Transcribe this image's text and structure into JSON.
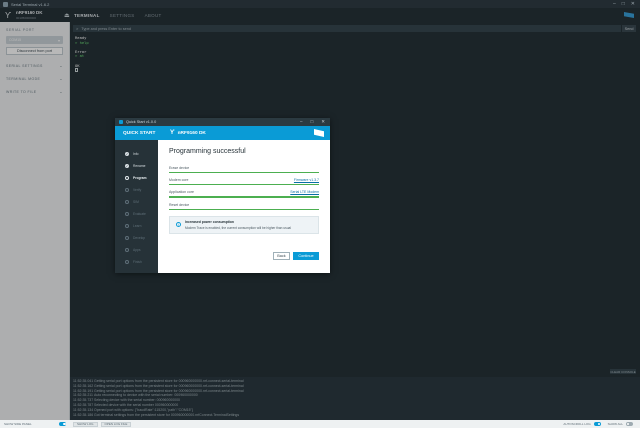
{
  "window": {
    "title": "Serial Terminal v1.6.2",
    "controls": [
      "–",
      "□",
      "✕"
    ]
  },
  "header": {
    "device_name": "nRF9160 DK",
    "device_serial": "001050000000",
    "tabs": [
      {
        "label": "TERMINAL",
        "active": true
      },
      {
        "label": "SETTINGS",
        "active": false
      },
      {
        "label": "ABOUT",
        "active": false
      }
    ]
  },
  "sidebar": {
    "serial_port_title": "SERIAL PORT",
    "port_value": "COM15",
    "disconnect_label": "Disconnect from port",
    "sections": [
      {
        "label": "SERIAL SETTINGS"
      },
      {
        "label": "TERMINAL MODE"
      },
      {
        "label": "WRITE TO FILE"
      }
    ]
  },
  "terminal": {
    "input_prompt": ">",
    "input_placeholder": "Type and press Enter to send",
    "send_label": "Send",
    "lines": [
      "Ready",
      "> help",
      "",
      "Error",
      "> at",
      "",
      "OK"
    ],
    "clear_label": "CLEAR CONSOLE"
  },
  "log": [
    {
      "time": "11:52:35.041",
      "msg": "Getting serial port options from the persistent store for 000960000000.nrf-connect-serial-terminal"
    },
    {
      "time": "11:52:35.162",
      "msg": "Getting serial port options from the persistent store for 000960000000.nrf-connect-serial-terminal"
    },
    {
      "time": "11:52:35.191",
      "msg": "Getting serial port options from the persistent store for 000960000000.nrf-connect-serial-terminal"
    },
    {
      "time": "11:52:35.211",
      "msg": "Auto reconnecting to device with the serial number: 000960000000"
    },
    {
      "time": "11:52:35.737",
      "msg": "Selecting device with the serial number: 000960000000"
    },
    {
      "time": "11:52:35.787",
      "msg": "Selected device with the serial number 000960000000"
    },
    {
      "time": "11:52:35.134",
      "msg": "Opened port with options: {\"baudRate\":115200,\"path\":\"COM15\"}"
    },
    {
      "time": "11:52:35.186",
      "msg": "Got terminal settings from the persistent store for 000960000000.nrfConnect.TerminalSettings"
    }
  ],
  "statusbar": {
    "show_side_panel": "SHOW SIDE PANEL",
    "show_log": "SHOW LOG",
    "open_log_file": "OPEN LOG FILE",
    "auto_scroll": "AUTOSCROLL LOG",
    "show_all": "SHOW ALL"
  },
  "dialog": {
    "window_title": "Quick Start v1.0.0",
    "header_left": "QUICK START",
    "header_device": "nRF9160 DK",
    "steps": [
      {
        "label": "Info",
        "state": "done"
      },
      {
        "label": "Rename",
        "state": "done"
      },
      {
        "label": "Program",
        "state": "current"
      },
      {
        "label": "Verify",
        "state": "todo"
      },
      {
        "label": "SIM",
        "state": "todo"
      },
      {
        "label": "Evaluate",
        "state": "todo"
      },
      {
        "label": "Learn",
        "state": "todo"
      },
      {
        "label": "Develop",
        "state": "todo"
      },
      {
        "label": "Apps",
        "state": "todo"
      },
      {
        "label": "Finish",
        "state": "todo"
      }
    ],
    "heading": "Programming successful",
    "tasks": [
      {
        "label": "Erase device",
        "link": "",
        "progress": 1.0
      },
      {
        "label": "Modem core",
        "link": "Firmware v1.3.7",
        "progress": 1.0
      },
      {
        "label": "Application core",
        "link": "Serial LTE Modem",
        "progress": 1.0
      },
      {
        "label": "Reset device",
        "link": "",
        "progress": 1.0
      }
    ],
    "notice": {
      "icon": "info-icon",
      "title": "Increased power consumption",
      "text": "Modem Trace is enabled, the current consumption will be higher than usual"
    },
    "back_label": "Back",
    "continue_label": "Continue"
  },
  "colors": {
    "accent": "#0a9bd6",
    "success": "#4caf50",
    "terminal_bg": "#263238"
  }
}
